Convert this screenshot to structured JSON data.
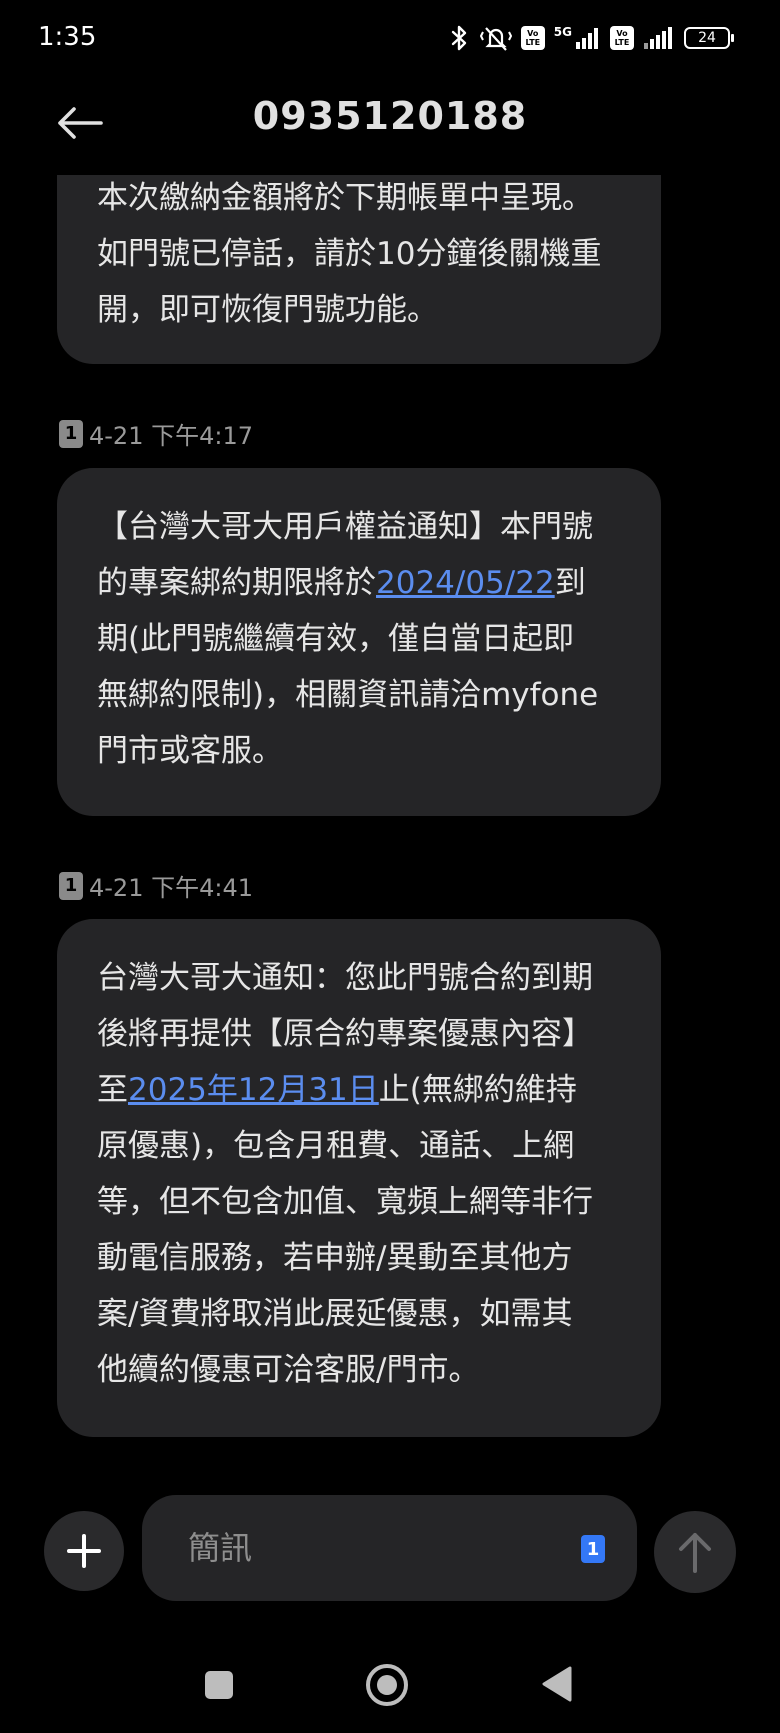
{
  "status_bar": {
    "time": "1:35",
    "net_type": "5G",
    "volte_line1": "Vo",
    "volte_line2": "LTE",
    "battery": "24"
  },
  "header": {
    "contact": "0935120188",
    "back_icon": "arrow-left-icon"
  },
  "messages": [
    {
      "lines": [
        "本次繳納金額將於下期帳單中呈現。",
        "如門號已停話，請於10分鐘後關機重",
        "開，即可恢復門號功能。"
      ]
    },
    {
      "sim": "1",
      "timestamp": "4-21 下午4:17",
      "line1": "【台灣大哥大用戶權益通知】本門號",
      "line2_before": "的專案綁約期限將於",
      "line2_link": "2024/05/22",
      "line2_after": "到",
      "line3": "期(此門號繼續有效，僅自當日起即",
      "line4": "無綁約限制)，相關資訊請洽myfone",
      "line5": "門市或客服。"
    },
    {
      "sim": "1",
      "timestamp": "4-21 下午4:41",
      "line1": "台灣大哥大通知：您此門號合約到期",
      "line2": "後將再提供【原合約專案優惠內容】",
      "line3_before": "至",
      "line3_link": "2025年12月31日",
      "line3_after": "止(無綁約維持",
      "line4": "原優惠)，包含月租費、通話、上網",
      "line5": "等，但不包含加值、寬頻上網等非行",
      "line6": "動電信服務，若申辦/異動至其他方",
      "line7": "案/資費將取消此展延優惠，如需其",
      "line8": "他續約優惠可洽客服/門市。"
    }
  ],
  "compose": {
    "placeholder": "簡訊",
    "sim": "1",
    "add_icon": "plus-icon",
    "send_icon": "arrow-up-icon"
  },
  "colors": {
    "background": "#000000",
    "bubble": "#252527",
    "link": "#5b8def",
    "sim_selected": "#3478f6"
  }
}
